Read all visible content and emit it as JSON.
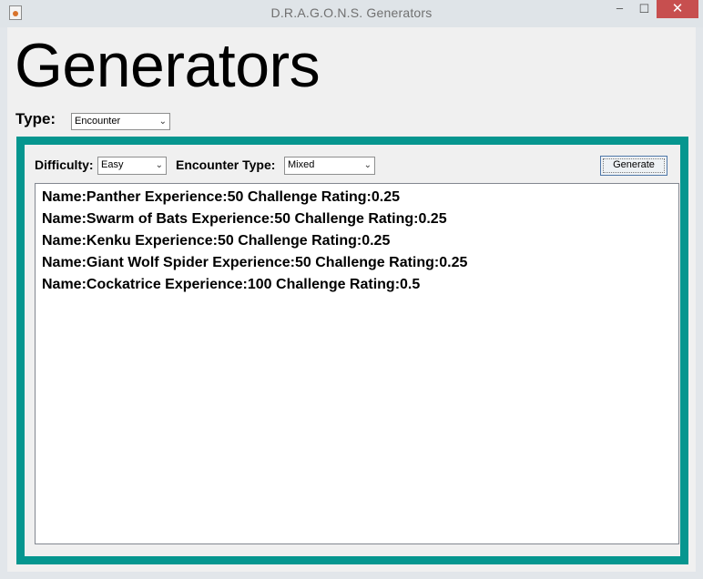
{
  "window": {
    "title": "D.R.A.G.O.N.S. Generators",
    "controls": {
      "minimize": "–",
      "maximize": "☐",
      "close": "✕"
    }
  },
  "heading": "Generators",
  "type": {
    "label": "Type:",
    "selected": "Encounter"
  },
  "toolbar": {
    "difficulty_label": "Difficulty:",
    "difficulty_selected": "Easy",
    "encounter_type_label": "Encounter Type:",
    "encounter_type_selected": "Mixed",
    "generate_label": "Generate"
  },
  "results": [
    "Name:Panther Experience:50 Challenge Rating:0.25",
    "Name:Swarm of Bats Experience:50 Challenge Rating:0.25",
    "Name:Kenku Experience:50 Challenge Rating:0.25",
    "Name:Giant Wolf Spider Experience:50 Challenge Rating:0.25",
    "Name:Cockatrice Experience:100 Challenge Rating:0.5"
  ],
  "colors": {
    "accent_border": "#06968f",
    "close_button": "#c74f4f"
  },
  "icons": {
    "app": "java-cup-icon",
    "dropdown": "chevron-down-icon"
  }
}
